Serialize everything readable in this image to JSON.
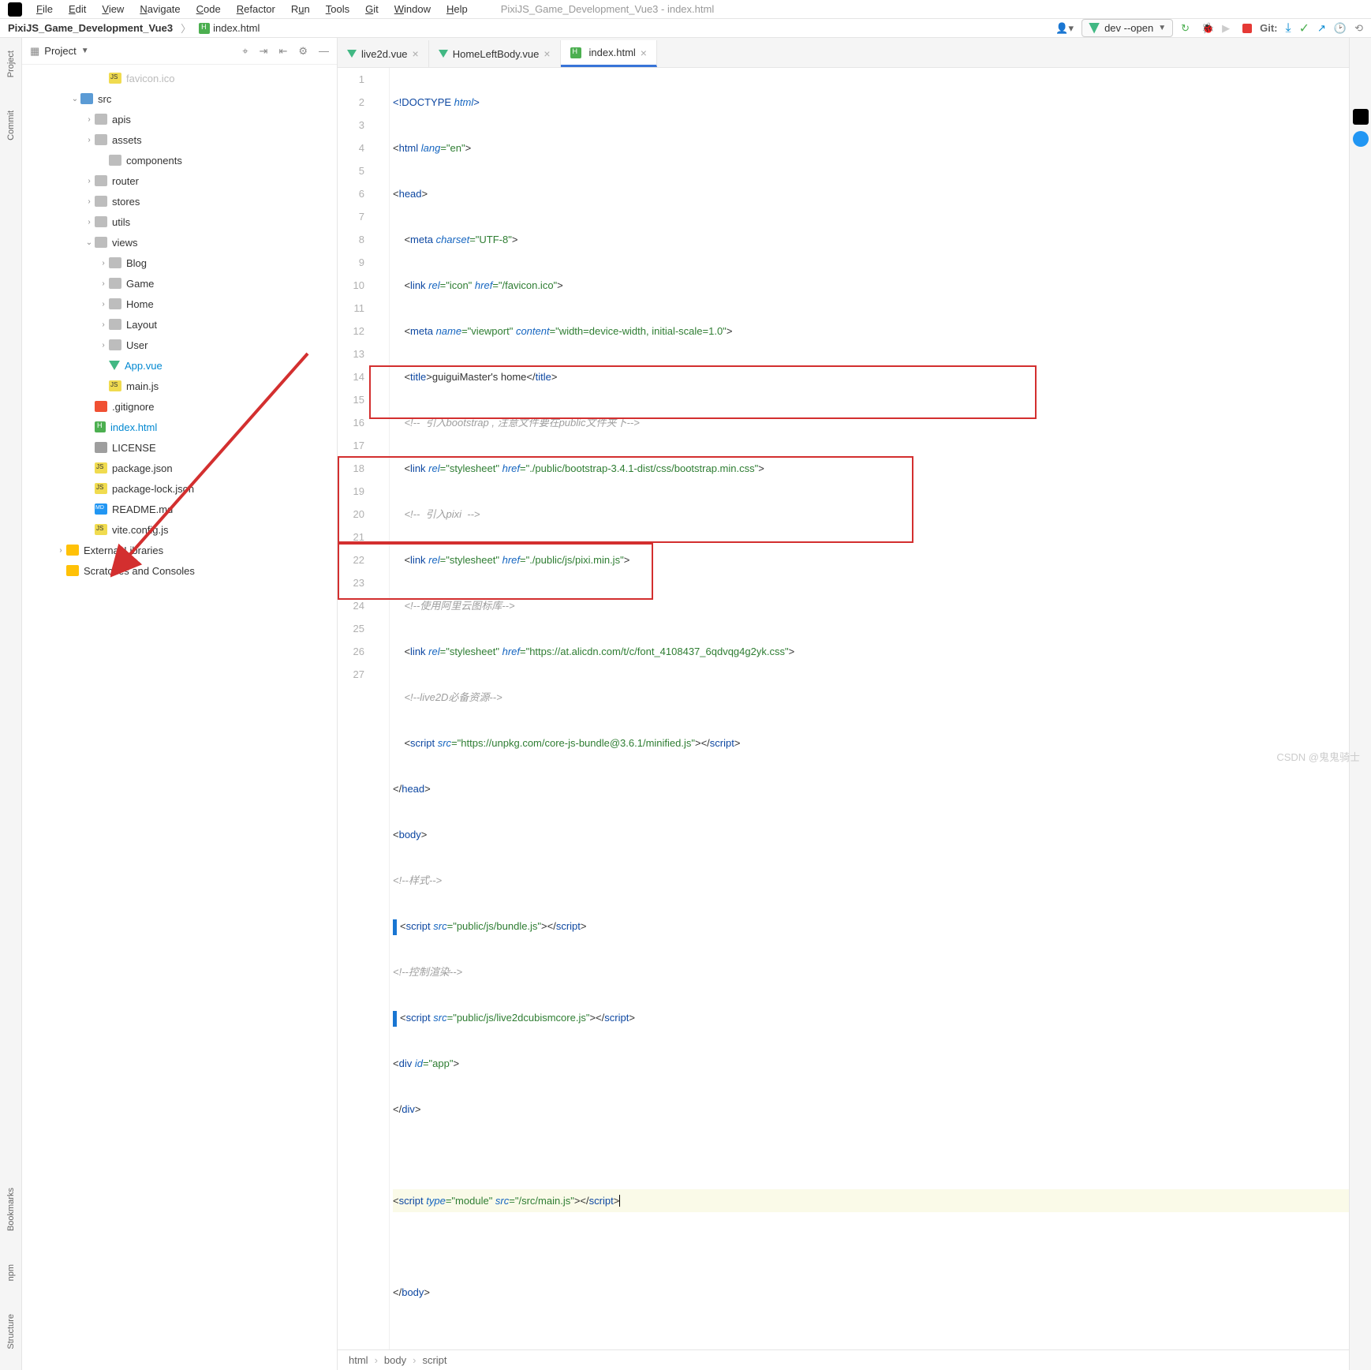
{
  "window": {
    "title": "PixiJS_Game_Development_Vue3 - index.html"
  },
  "menu": {
    "items": [
      "File",
      "Edit",
      "View",
      "Navigate",
      "Code",
      "Refactor",
      "Run",
      "Tools",
      "Git",
      "Window",
      "Help"
    ]
  },
  "breadcrumb": {
    "project": "PixiJS_Game_Development_Vue3",
    "file": "index.html"
  },
  "run_config": "dev --open",
  "git_label": "Git:",
  "project_header": "Project",
  "tree": {
    "favicon": "favicon.ico",
    "src": "src",
    "apis": "apis",
    "assets": "assets",
    "components": "components",
    "router": "router",
    "stores": "stores",
    "utils": "utils",
    "views": "views",
    "blog": "Blog",
    "game": "Game",
    "home": "Home",
    "layout": "Layout",
    "user": "User",
    "appvue": "App.vue",
    "mainjs": "main.js",
    "gitignore": ".gitignore",
    "indexhtml": "index.html",
    "license": "LICENSE",
    "pkg": "package.json",
    "pkglock": "package-lock.json",
    "readme": "README.md",
    "viteconf": "vite.config.js",
    "extlib": "External Libraries",
    "scratches": "Scratches and Consoles"
  },
  "tabs": {
    "t1": "live2d.vue",
    "t2": "HomeLeftBody.vue",
    "t3": "index.html"
  },
  "code": {
    "l1_a": "<!DOCTYPE ",
    "l1_b": "html",
    "l1_c": ">",
    "l2_a": "<",
    "l2_b": "html ",
    "l2_c": "lang",
    "l2_d": "=\"en\"",
    "l2_e": ">",
    "l3_a": "<",
    "l3_b": "head",
    "l3_c": ">",
    "l4_a": "    <",
    "l4_b": "meta ",
    "l4_c": "charset",
    "l4_d": "=\"UTF-8\"",
    "l4_e": ">",
    "l5_a": "    <",
    "l5_b": "link ",
    "l5_c": "rel",
    "l5_d": "=\"icon\" ",
    "l5_e": "href",
    "l5_f": "=\"/favicon.ico\"",
    "l5_g": ">",
    "l6_a": "    <",
    "l6_b": "meta ",
    "l6_c": "name",
    "l6_d": "=\"viewport\" ",
    "l6_e": "content",
    "l6_f": "=\"width=device-width, initial-scale=1.0\"",
    "l6_g": ">",
    "l7_a": "    <",
    "l7_b": "title",
    "l7_c": ">guiguiMaster's home</",
    "l7_d": "title",
    "l7_e": ">",
    "l8": "    <!--  引入bootstrap , 注意文件要在public文件夹下-->",
    "l9_a": "    <",
    "l9_b": "link ",
    "l9_c": "rel",
    "l9_d": "=\"stylesheet\" ",
    "l9_e": "href",
    "l9_f": "=\"./public/bootstrap-3.4.1-dist/css/bootstrap.min.css\"",
    "l9_g": ">",
    "l10": "    <!--  引入pixi  -->",
    "l11_a": "    <",
    "l11_b": "link ",
    "l11_c": "rel",
    "l11_d": "=\"stylesheet\" ",
    "l11_e": "href",
    "l11_f": "=\"./public/js/pixi.min.js\"",
    "l11_g": ">",
    "l12": "    <!--使用阿里云图标库-->",
    "l13_a": "    <",
    "l13_b": "link ",
    "l13_c": "rel",
    "l13_d": "=\"stylesheet\" ",
    "l13_e": "href",
    "l13_f": "=\"https://at.alicdn.com/t/c/font_4108437_6qdvqg4g2yk.css\"",
    "l13_g": ">",
    "l14": "    <!--live2D必备资源-->",
    "l15_a": "    <",
    "l15_b": "script ",
    "l15_c": "src",
    "l15_d": "=\"https://unpkg.com/core-js-bundle@3.6.1/minified.js\"",
    "l15_e": "></",
    "l15_f": "script",
    "l15_g": ">",
    "l16_a": "</",
    "l16_b": "head",
    "l16_c": ">",
    "l17_a": "<",
    "l17_b": "body",
    "l17_c": ">",
    "l18": "<!--样式-->",
    "l19_a": "<",
    "l19_b": "script ",
    "l19_c": "src",
    "l19_d": "=\"public/js/bundle.js\"",
    "l19_e": "></",
    "l19_f": "script",
    "l19_g": ">",
    "l20": "<!--控制渲染-->",
    "l21_a": "<",
    "l21_b": "script ",
    "l21_c": "src",
    "l21_d": "=\"public/js/live2dcubismcore.js\"",
    "l21_e": "></",
    "l21_f": "script",
    "l21_g": ">",
    "l22_a": "<",
    "l22_b": "div ",
    "l22_c": "id",
    "l22_d": "=\"app\"",
    "l22_e": ">",
    "l23_a": "</",
    "l23_b": "div",
    "l23_c": ">",
    "l25_a": "<",
    "l25_b": "script ",
    "l25_c": "type",
    "l25_d": "=\"module\" ",
    "l25_e": "src",
    "l25_f": "=\"/src/main.js\"",
    "l25_g": "></",
    "l25_h": "script",
    "l25_i": ">",
    "l27_a": "</",
    "l27_b": "body",
    "l27_c": ">"
  },
  "crumbs": {
    "c1": "html",
    "c2": "body",
    "c3": "script"
  },
  "watermark": "CSDN @鬼鬼骑士",
  "line_numbers": [
    "1",
    "2",
    "3",
    "4",
    "5",
    "6",
    "7",
    "8",
    "9",
    "10",
    "11",
    "12",
    "13",
    "14",
    "15",
    "16",
    "17",
    "18",
    "19",
    "20",
    "21",
    "22",
    "23",
    "24",
    "25",
    "26",
    "27"
  ]
}
